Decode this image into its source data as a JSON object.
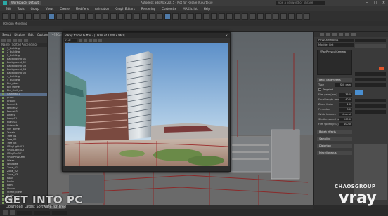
{
  "window": {
    "workspace": "Workspace: Default",
    "title": "Autodesk 3ds Max 2015 - Not for Resale (Courtesy)",
    "search_placeholder": "Type a keyword or phrase"
  },
  "menu": [
    "Edit",
    "Tools",
    "Group",
    "Views",
    "Create",
    "Modifiers",
    "Animation",
    "Graph Editors",
    "Rendering",
    "Customize",
    "MAXScript",
    "Help"
  ],
  "ribbon_label": "Polygon Modeling",
  "explorer": {
    "tabs": [
      "Select",
      "Display",
      "Edit",
      "Customize"
    ],
    "column_header": "Name (Sorted Ascending)",
    "items": [
      "1_building",
      "2_building",
      "3_building",
      "Background_01",
      "Background_02",
      "Background_03",
      "Background_04",
      "Background_05",
      "4_building",
      "5_building",
      "Bld_glass",
      "Bld_frame",
      "Bld_shell_ext",
      "Camera01",
      "grass",
      "ground",
      "Fence01",
      "Fence02",
      "Fence03",
      "Line01",
      "Lamp01",
      "Plane01",
      "Sidewalk",
      "Sky_dome",
      "Terrain",
      "Tree_01",
      "Tree_02",
      "Tree_03",
      "VRayLight001",
      "VRayLight002",
      "VRaySun001",
      "VRayPhysCam",
      "Water",
      "Windows",
      "Zone_01",
      "Zone_02",
      "Zone_03",
      "Road",
      "Rocks",
      "Path",
      "Shrubs",
      "Street_lights",
      "Stairs",
      "Walls",
      "FloorLevel"
    ]
  },
  "viewport_label": "[+] [Camera001] [Realistic]",
  "vfb": {
    "title": "V-Ray frame buffer - [100% of 1280 x 960]",
    "channel": "RGB color"
  },
  "command_panel": {
    "object_name": "PhysCamera001",
    "list_header": "Modifier List",
    "stack_item": "VRayPhysicalCamera",
    "rollouts": [
      "Basic parameters",
      "Bokeh effects",
      "Sampling",
      "Distortion",
      "Miscellaneous"
    ],
    "labels": {
      "type": "Type",
      "targeted": "Targeted",
      "film_gate": "Film gate (mm)",
      "focal_length": "Focal length (mm)",
      "zoom_factor": "Zoom factor",
      "f_number": "F-number",
      "white_balance": "White balance",
      "shutter_speed": "Shutter speed (s^-1)",
      "film_speed": "Film speed (ISO)"
    },
    "values": {
      "type": "Still cam",
      "film_gate": "36.0",
      "focal_length": "40.0",
      "zoom_factor": "1.0",
      "f_number": "8.0",
      "white_balance": "Neutral",
      "shutter_speed": "200.0",
      "film_speed": "100.0"
    },
    "accent_color": "#e2542a"
  },
  "watermark": {
    "getinto": "GET INTO PC",
    "getinto_sub": "Download Latest Software for Free",
    "chaos": "CHAOSGROUP",
    "vray": "vray"
  }
}
